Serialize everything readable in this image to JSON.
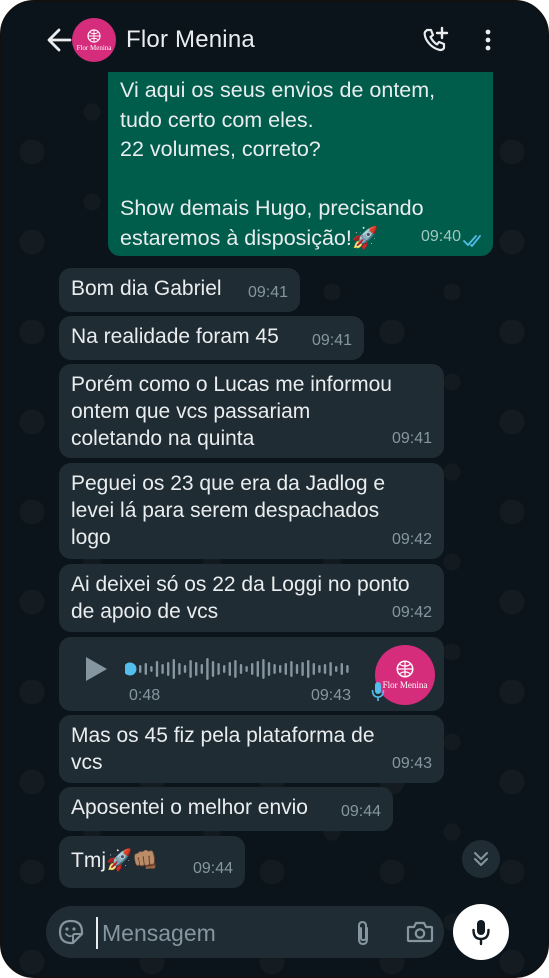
{
  "header": {
    "contact_name": "Flor Menina",
    "avatar_text": "Flor Menina"
  },
  "messages": [
    {
      "direction": "out",
      "text": "Vi aqui os seus envios de ontem,\ntudo certo com eles.\n22 volumes, correto?\n\nShow demais Hugo, precisando\nestaremos à disposição!🚀",
      "time": "09:40",
      "status": "read"
    },
    {
      "direction": "in",
      "text": "Bom dia Gabriel",
      "time": "09:41"
    },
    {
      "direction": "in",
      "text": "Na realidade foram 45",
      "time": "09:41"
    },
    {
      "direction": "in",
      "text": "Porém como o Lucas me informou\nontem que vcs passariam\ncoletando na quinta",
      "time": "09:41"
    },
    {
      "direction": "in",
      "text": "Peguei os 23 que era da Jadlog e\nlevei lá para serem despachados\nlogo",
      "time": "09:42"
    },
    {
      "direction": "in",
      "text": "Ai deixei só os 22 da Loggi no ponto\nde apoio de vcs",
      "time": "09:42"
    },
    {
      "direction": "in",
      "text": "Mas os 45 fiz pela plataforma de\nvcs",
      "time": "09:43"
    },
    {
      "direction": "in",
      "text": "Aposentei o melhor envio",
      "time": "09:44"
    },
    {
      "direction": "in",
      "text": "Tmj🚀👊🏽",
      "time": "09:44"
    }
  ],
  "audio": {
    "duration": "0:48",
    "time": "09:43",
    "avatar_text": "Flor Menina",
    "progress": 0
  },
  "composer": {
    "placeholder": "Mensagem"
  },
  "colors": {
    "background": "#0b141a",
    "incoming_bubble": "#202c33",
    "outgoing_bubble": "#005c4b",
    "avatar": "#d62c7c",
    "read_ticks": "#53bdeb"
  }
}
